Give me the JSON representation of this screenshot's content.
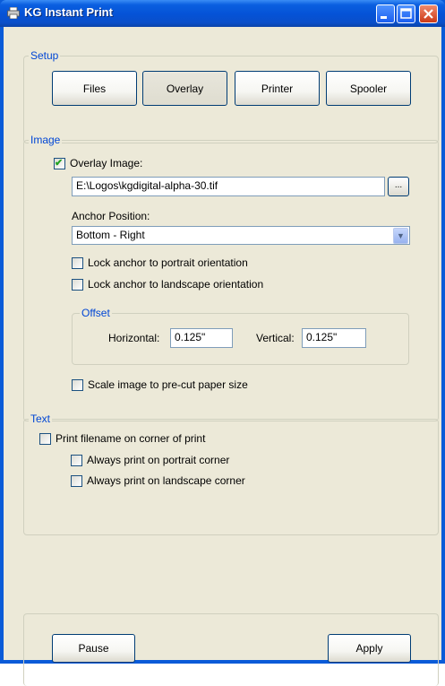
{
  "window": {
    "title": "KG Instant Print",
    "icon": "printer-app-icon"
  },
  "setup": {
    "label": "Setup",
    "buttons": {
      "files": "Files",
      "overlay": "Overlay",
      "printer": "Printer",
      "spooler": "Spooler"
    }
  },
  "image": {
    "label": "Image",
    "overlay_image": {
      "label": "Overlay Image:",
      "checked": true
    },
    "path_value": "E:\\Logos\\kgdigital-alpha-30.tif",
    "browse_label": "...",
    "anchor_label": "Anchor Position:",
    "anchor_value": "Bottom - Right",
    "lock_portrait": "Lock anchor to portrait orientation",
    "lock_landscape": "Lock anchor to landscape orientation",
    "offset": {
      "label": "Offset",
      "horizontal_label": "Horizontal:",
      "horizontal_value": "0.125\"",
      "vertical_label": "Vertical:",
      "vertical_value": "0.125\""
    },
    "scale": "Scale image to pre-cut paper size"
  },
  "text": {
    "label": "Text",
    "print_filename": "Print filename on corner of print",
    "portrait_corner": "Always print on portrait corner",
    "landscape_corner": "Always print on landscape corner"
  },
  "footer": {
    "pause": "Pause",
    "apply": "Apply"
  }
}
